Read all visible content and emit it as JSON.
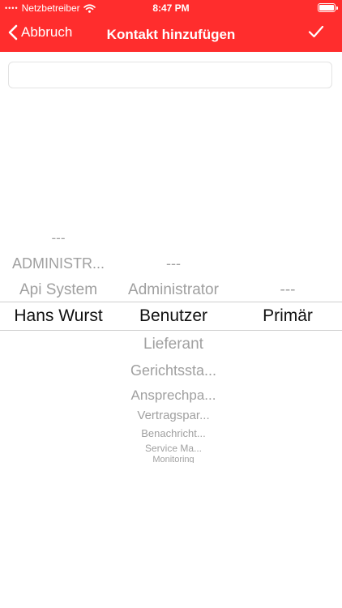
{
  "status_bar": {
    "carrier": "Netzbetreiber",
    "time": "8:47 PM"
  },
  "nav": {
    "back_label": "Abbruch",
    "title": "Kontakt hinzufügen"
  },
  "search": {
    "value": "",
    "placeholder": ""
  },
  "picker": {
    "columns": [
      {
        "items": [
          "---",
          "ADMINISTR...",
          "Api System",
          "Hans Wurst"
        ],
        "selected": "Hans Wurst"
      },
      {
        "items": [
          "---",
          "Administrator",
          "Benutzer",
          "Lieferant",
          "Gerichtssta...",
          "Ansprechpa...",
          "Vertragspar...",
          "Benachricht...",
          "Service Ma...",
          "Monitoring"
        ],
        "selected": "Benutzer"
      },
      {
        "items": [
          "---",
          "Primär"
        ],
        "selected": "Primär"
      }
    ]
  },
  "colors": {
    "brand": "#ff2d2d",
    "selected_text": "#111111",
    "unselected_text": "#a0a0a0"
  }
}
